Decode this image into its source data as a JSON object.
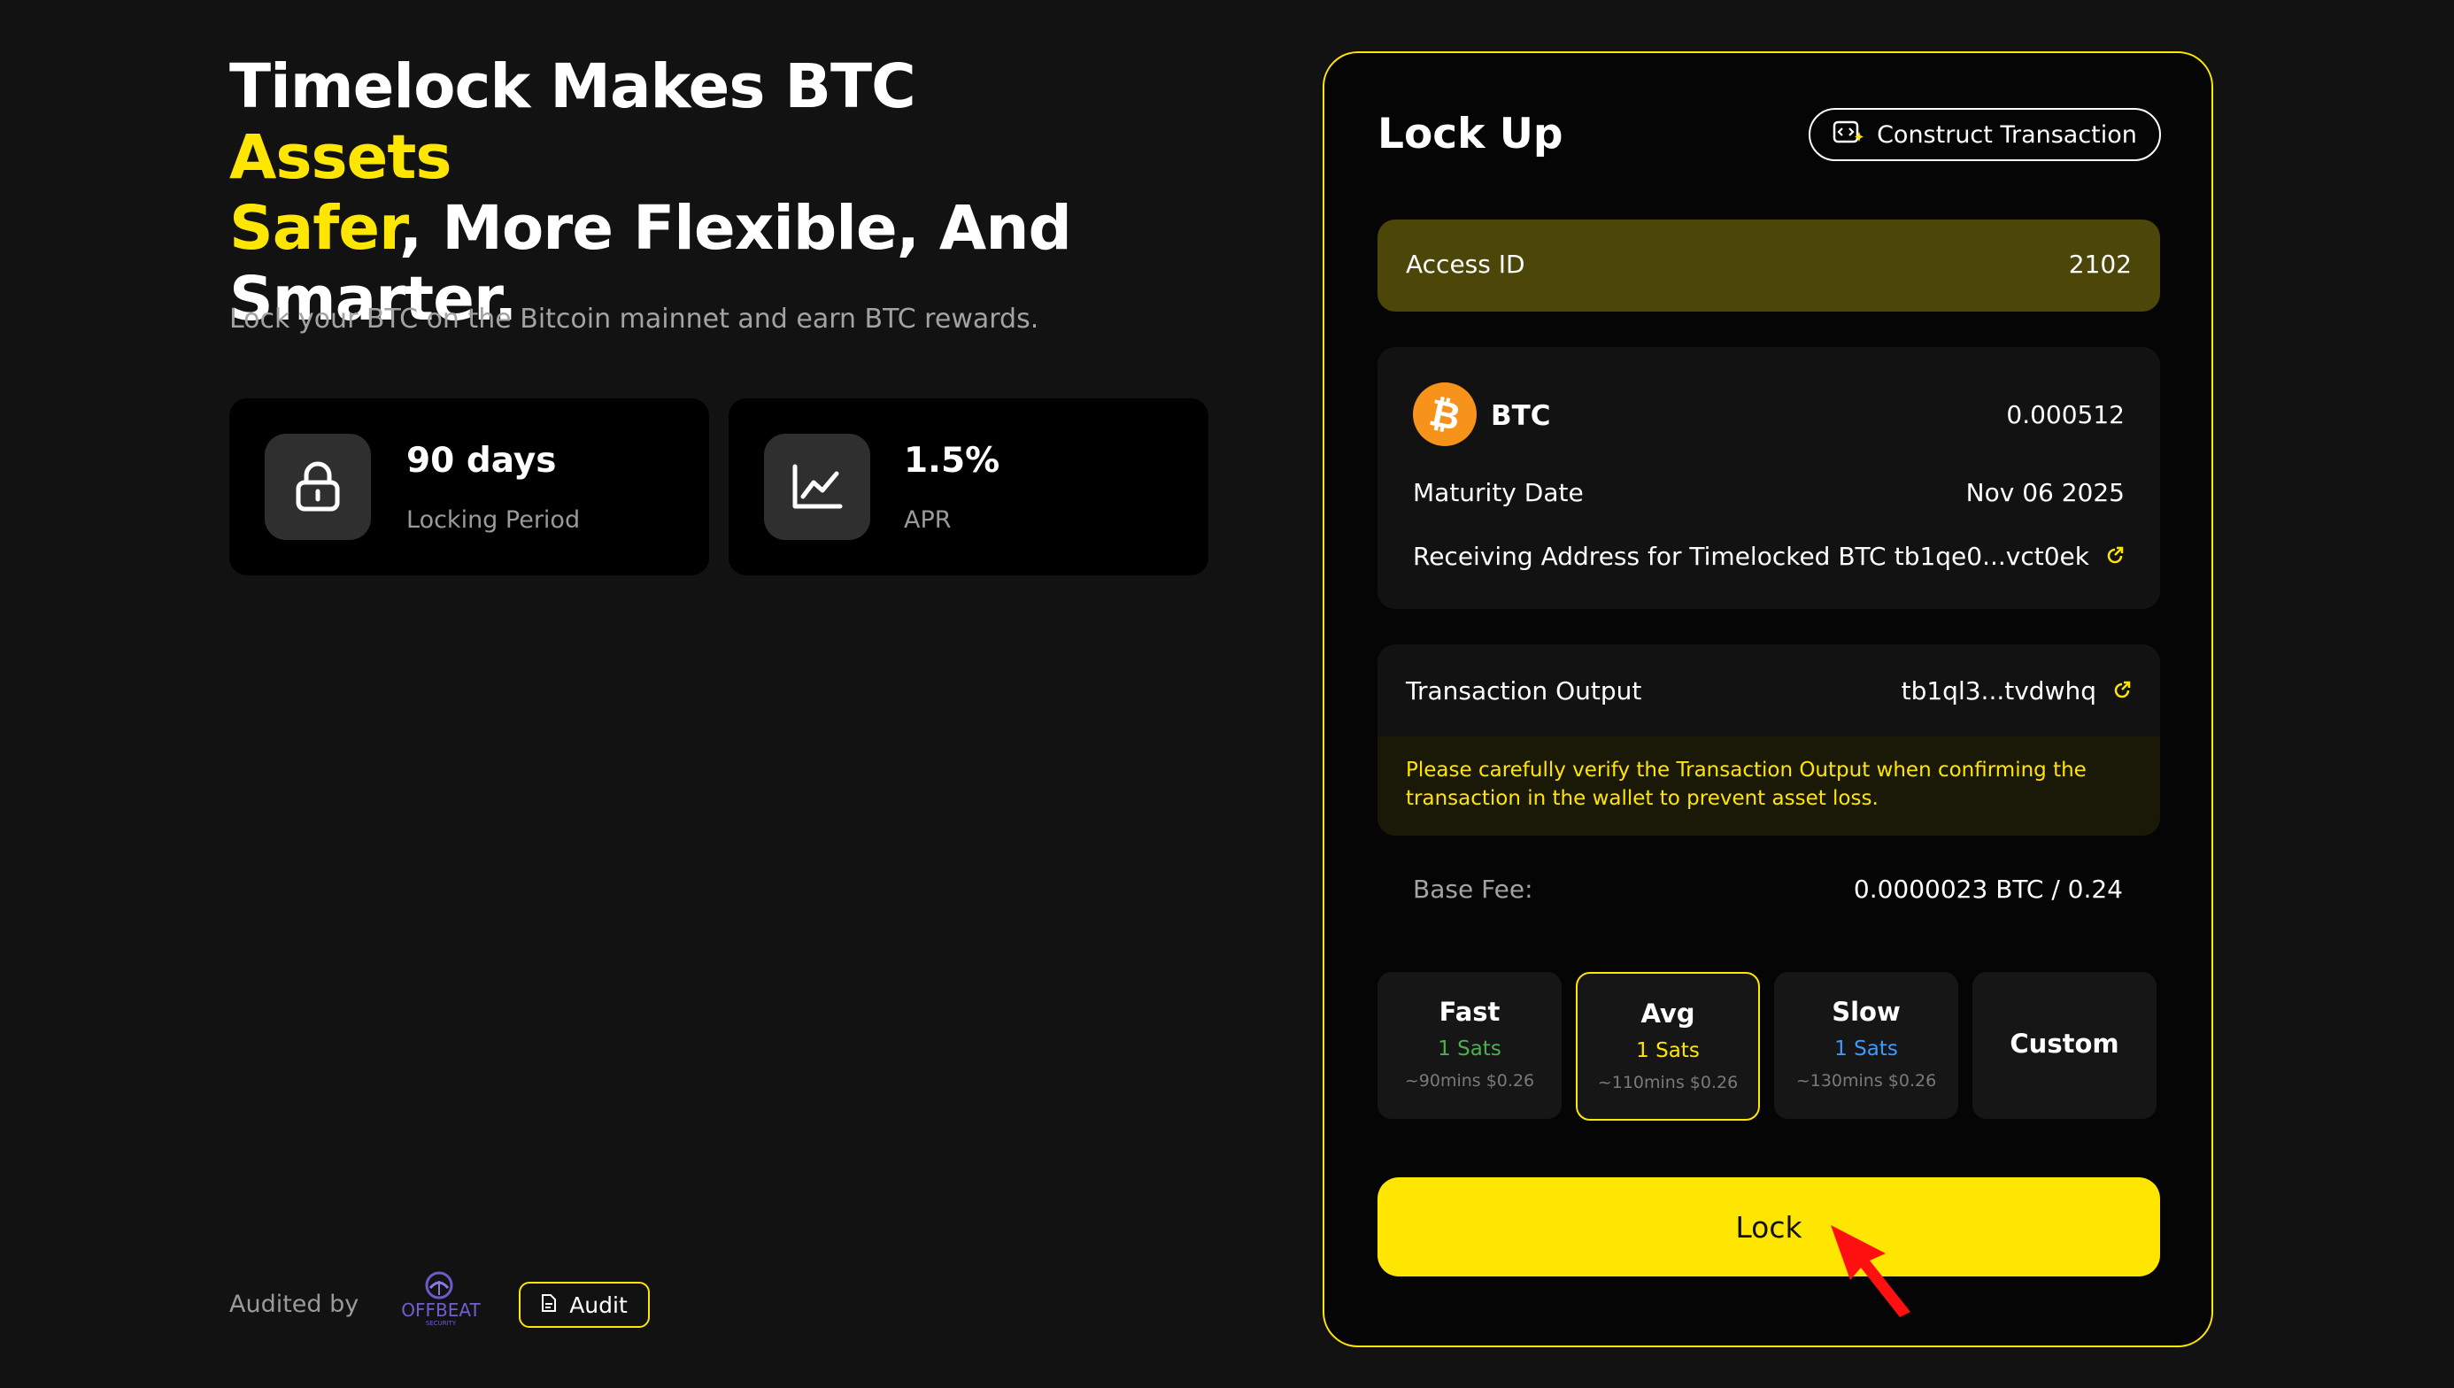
{
  "hero": {
    "line1_a": "Timelock Makes BTC ",
    "line1_hl": "Assets",
    "line2_hl": "Safer",
    "line2_b": ", More Flexible, And",
    "line3": "Smarter.",
    "subtitle": "Lock your BTC on the Bitcoin mainnet and earn BTC rewards."
  },
  "stats": [
    {
      "value": "90 days",
      "label": "Locking Period",
      "icon": "lock-icon"
    },
    {
      "value": "1.5%",
      "label": "APR",
      "icon": "chart-line-icon"
    }
  ],
  "footer": {
    "audited_label": "Audited by",
    "auditor_logo_text": "OFFBEAT",
    "auditor_logo_subtext": "SECURITY",
    "audit_button": "Audit"
  },
  "panel": {
    "title": "Lock Up",
    "construct_button": "Construct Transaction",
    "access_id_label": "Access ID",
    "access_id_value": "2102",
    "asset_name": "BTC",
    "asset_amount": "0.000512",
    "maturity_label": "Maturity Date",
    "maturity_value": "Nov 06 2025",
    "receiving_label": "Receiving Address for Timelocked BTC",
    "receiving_value": "tb1qe0...vct0ek",
    "tx_output_label": "Transaction Output",
    "tx_output_value": "tb1ql3...tvdwhq",
    "warning": "Please carefully verify the Transaction Output when confirming the transaction in the wallet to prevent asset loss.",
    "base_fee_label": "Base Fee:",
    "base_fee_value": "0.0000023 BTC / 0.24",
    "fee_options": [
      {
        "name": "Fast",
        "sats": "1 Sats",
        "time": "~90mins $0.26",
        "color": "#4caf50"
      },
      {
        "name": "Avg",
        "sats": "1 Sats",
        "time": "~110mins $0.26",
        "color": "#ffe600",
        "selected": true
      },
      {
        "name": "Slow",
        "sats": "1 Sats",
        "time": "~130mins $0.26",
        "color": "#3b9cff"
      },
      {
        "name": "Custom"
      }
    ],
    "lock_button": "Lock"
  },
  "colors": {
    "accent": "#ffe600",
    "background": "#121212",
    "panel": "#050505",
    "btc": "#f7931a"
  }
}
